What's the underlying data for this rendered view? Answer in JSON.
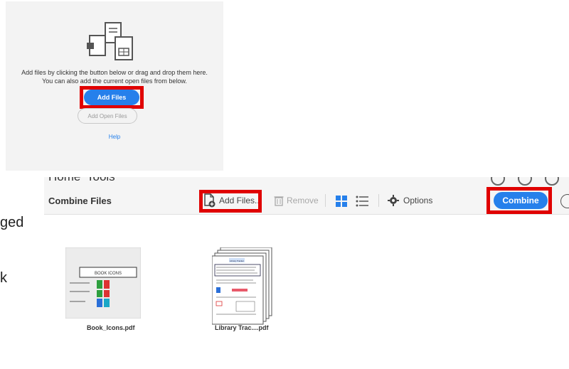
{
  "top_panel": {
    "instruction_line1": "Add files by clicking the button below or drag and drop them here.",
    "instruction_line2": "You can also add the current open files from below.",
    "add_files_label": "Add Files",
    "add_open_files_label": "Add Open Files",
    "help_label": "Help",
    "icon": "documents-icon"
  },
  "left_fragments": {
    "line1": "ged",
    "line2": "k"
  },
  "app": {
    "nav": {
      "home_label": "Home",
      "tools_label": "Tools"
    },
    "toolbar": {
      "title": "Combine Files",
      "add_files_label": "Add Files...",
      "remove_label": "Remove",
      "options_label": "Options",
      "combine_label": "Combine"
    },
    "files": [
      {
        "name": "Book_Icons.pdf",
        "thumb_title": "BOOK ICONS"
      },
      {
        "name": "Library Trac....pdf",
        "thumb_title": "Library Tracker"
      }
    ]
  },
  "colors": {
    "accent": "#2680eb",
    "highlight": "#e00000"
  }
}
